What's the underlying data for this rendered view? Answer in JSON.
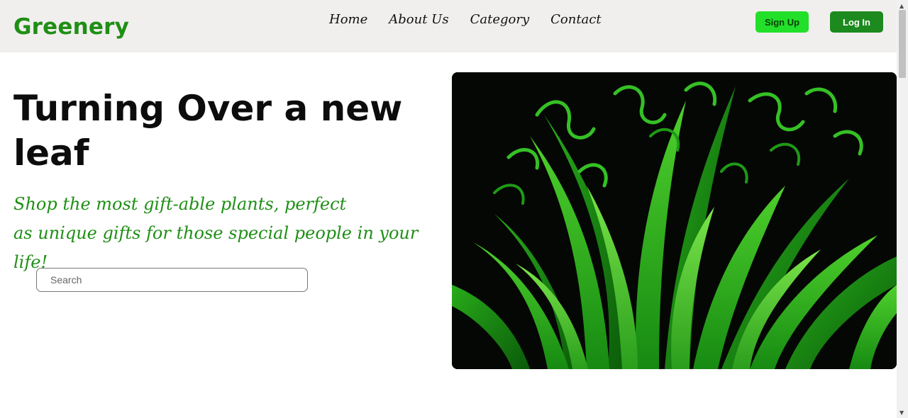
{
  "header": {
    "brand": "Greenery",
    "nav": [
      "Home",
      "About Us",
      "Category",
      "Contact"
    ],
    "signup_label": "Sign Up",
    "login_label": "Log In"
  },
  "hero": {
    "title": "Turning Over a new leaf",
    "subtitle_line1": "Shop the most gift-able plants, perfect",
    "subtitle_line2": "as unique gifts for those special people in your life!",
    "search_placeholder": "Search",
    "image_alt": "green grass leaves on black background"
  },
  "colors": {
    "brand_green": "#1f8f15",
    "signup_bg": "#22e02a",
    "login_bg": "#1c8a1e",
    "header_bg": "#f1efee"
  },
  "icons": [
    "chevron-up-icon",
    "chevron-down-icon"
  ]
}
